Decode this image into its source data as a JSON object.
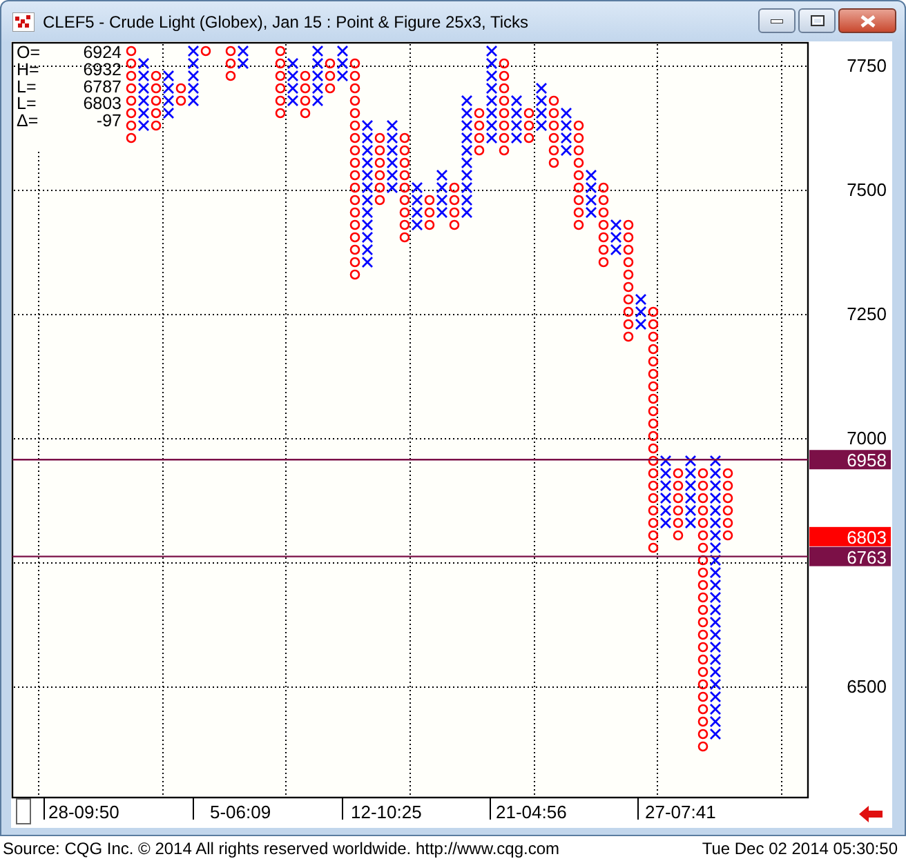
{
  "window": {
    "title": "CLEF5 - Crude Light (Globex), Jan 15 : Point & Figure 25x3, Ticks"
  },
  "stats": [
    {
      "label": "O=",
      "value": "6924"
    },
    {
      "label": "H=",
      "value": "6932"
    },
    {
      "label": "L=",
      "value": "6787"
    },
    {
      "label": "L=",
      "value": "6803"
    },
    {
      "label": "Δ=",
      "value": "-97"
    }
  ],
  "chart": {
    "price_axis": [
      "7750",
      "7500",
      "7250",
      "7000",
      "6500"
    ],
    "price_tags": [
      {
        "kind": "level",
        "label": "6958"
      },
      {
        "kind": "last",
        "label": "6803"
      },
      {
        "kind": "level",
        "label": "6763"
      }
    ],
    "time_axis": [
      "28-09:50",
      "5-06:09",
      "12-10:25",
      "21-04:56",
      "27-07:41"
    ]
  },
  "footer": {
    "source": "Source: CQG Inc. © 2014 All rights reserved worldwide. http://www.cqg.com",
    "timestamp": "Tue Dec 02 2014 05:30:50"
  }
}
